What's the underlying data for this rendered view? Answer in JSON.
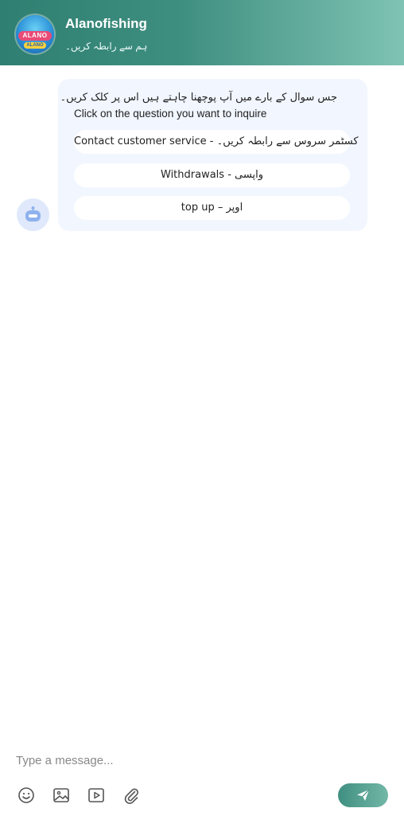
{
  "header": {
    "logo_text": "ALANO",
    "logo_subtext": "ALANO",
    "title": "Alanofishing",
    "subtitle": "ہم سے رابطہ کریں۔"
  },
  "chat": {
    "prompt_urdu": "جس سوال کے بارے میں آپ پوچھنا چاہتے ہیں اس پر کلک کریں۔",
    "prompt_english": "Click on the question you want to inquire",
    "options": [
      {
        "label": "Contact customer service - کسٹمر سروس سے رابطہ کریں۔"
      },
      {
        "label": "Withdrawals - واپسی"
      },
      {
        "label": "top up – اوپر"
      }
    ]
  },
  "composer": {
    "placeholder": "Type a message...",
    "icons": [
      "emoji-icon",
      "image-icon",
      "video-icon",
      "attachment-icon",
      "send-icon"
    ]
  },
  "colors": {
    "header_start": "#2f7f72",
    "header_end": "#7fc3b4",
    "bubble_bg": "#f1f6ff",
    "avatar_bg": "#dfe9fb"
  }
}
